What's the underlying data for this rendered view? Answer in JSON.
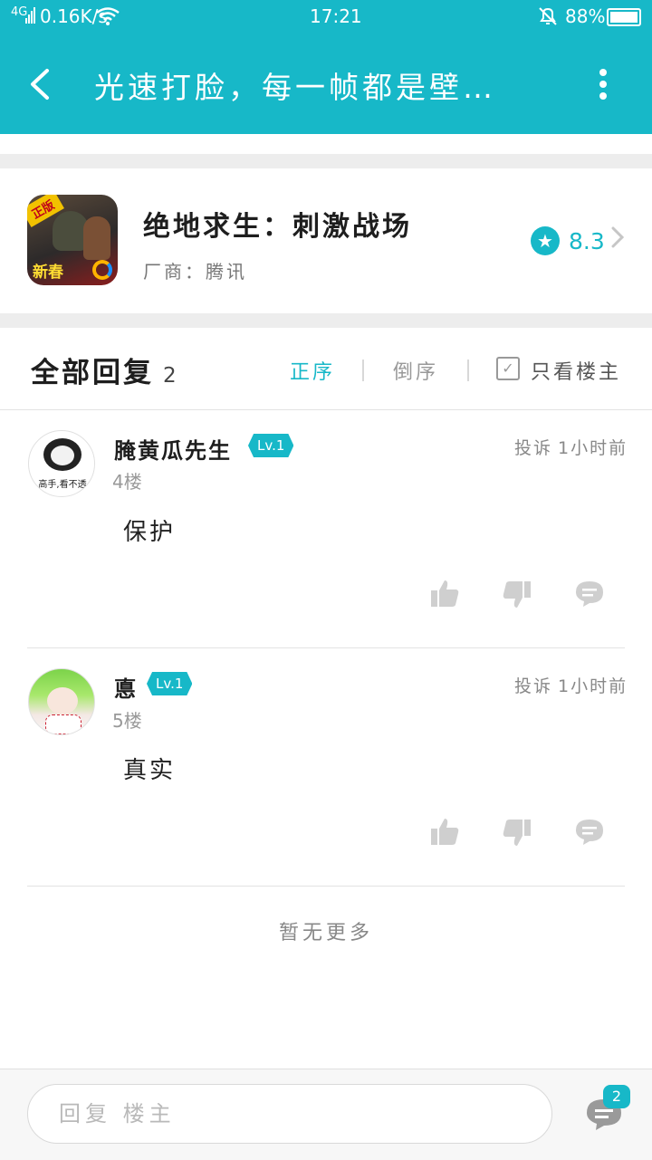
{
  "status_bar": {
    "network": "4G",
    "speed": "0.16K/s",
    "time": "17:21",
    "battery": "88%"
  },
  "header": {
    "title": "光速打脸，每一帧都是壁…",
    "back_icon": "chevron-left-icon",
    "more_icon": "more-vertical-icon"
  },
  "game": {
    "icon_badge": "正版",
    "icon_label": "新春",
    "name": "绝地求生：刺激战场",
    "vendor": "厂商：腾讯",
    "rating": "8.3"
  },
  "replies": {
    "title": "全部回复",
    "count": "2",
    "sort_asc": "正序",
    "sort_desc": "倒序",
    "only_op": "只看楼主",
    "only_op_checked": true
  },
  "comments": [
    {
      "user": "腌黄瓜先生",
      "level": "Lv.1",
      "report": "投诉",
      "time": "1小时前",
      "floor": "4楼",
      "content": "保护",
      "avatar_caption": "高手,看不透"
    },
    {
      "user": "悳",
      "level": "Lv.1",
      "report": "投诉",
      "time": "1小时前",
      "floor": "5楼",
      "content": "真实"
    }
  ],
  "footer_note": "暂无更多",
  "bottom": {
    "reply_placeholder": "回复 楼主",
    "comment_count": "2"
  },
  "colors": {
    "accent": "#17b8c8",
    "background": "#ffffff",
    "divider": "#ededed"
  }
}
